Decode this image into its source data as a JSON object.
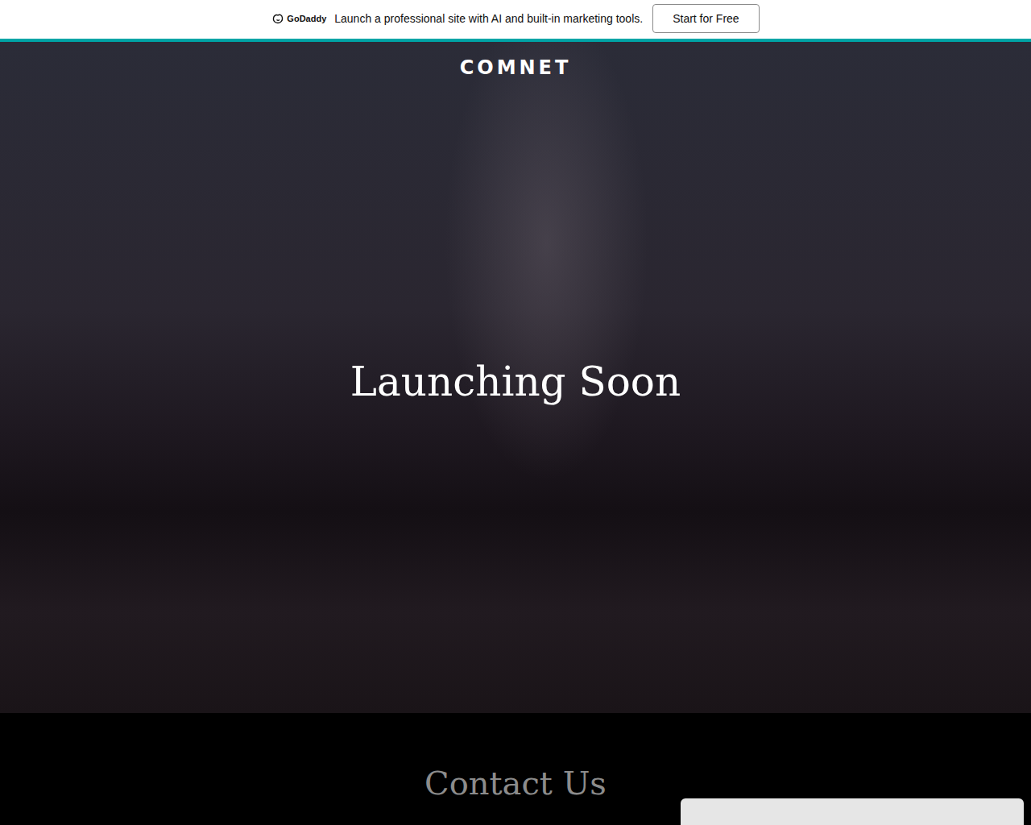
{
  "banner": {
    "brand": "GoDaddy",
    "message": "Launch a professional site with AI and built-in marketing tools.",
    "button": "Start for Free"
  },
  "site": {
    "title": "COMNET"
  },
  "hero": {
    "heading": "Launching Soon"
  },
  "contact": {
    "heading": "Contact Us"
  },
  "cookie_popup": {
    "visible": true
  }
}
